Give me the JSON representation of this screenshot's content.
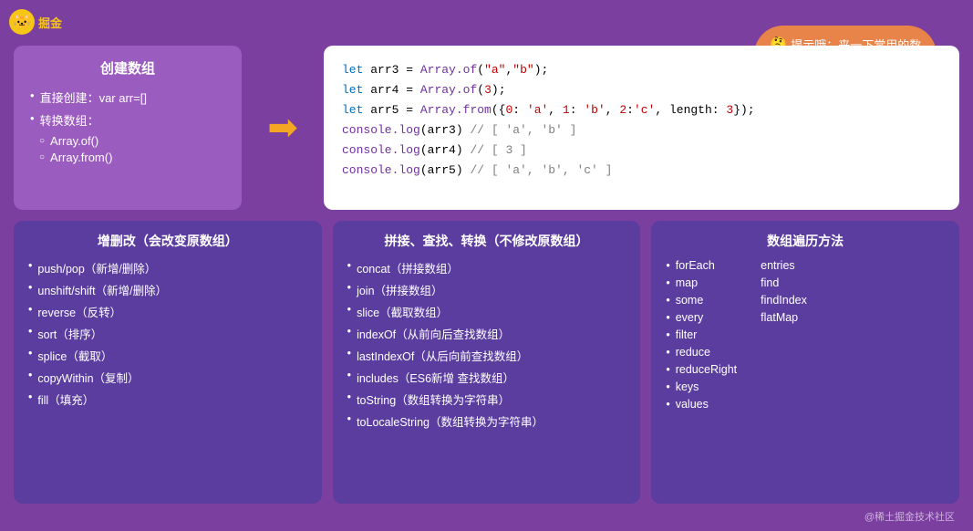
{
  "logo": {
    "icon": "🐱",
    "text": "掘金"
  },
  "tooltip": {
    "emoji": "🤔",
    "text": "提示哦：来一下常用的数组方法看看啥"
  },
  "create_box": {
    "title": "创建数组",
    "items": [
      "直接创建：var arr=[]",
      "转换数组："
    ],
    "sub_items": [
      "Array.of()",
      "Array.from()"
    ]
  },
  "code": {
    "lines": [
      {
        "text": "let arr3 = Array.of(\"a\",\"b\");"
      },
      {
        "text": "let arr4 = Array.of(3);"
      },
      {
        "text": "let arr5 = Array.from({0: 'a', 1: 'b', 2:'c', length: 3});"
      },
      {
        "text": "console.log(arr3) // [ 'a', 'b' ]"
      },
      {
        "text": "console.log(arr4) // [ 3 ]"
      },
      {
        "text": "console.log(arr5) // [ 'a', 'b', 'c' ]"
      }
    ]
  },
  "mutate_box": {
    "title": "增删改（会改变原数组）",
    "items": [
      "push/pop（新增/删除）",
      "unshift/shift（新增/删除）",
      "reverse（反转）",
      "sort（排序）",
      "splice（截取）",
      "copyWithin（复制）",
      "fill（填充）"
    ]
  },
  "search_box": {
    "title": "拼接、查找、转换（不修改原数组）",
    "items": [
      "concat（拼接数组）",
      "join（拼接数组）",
      "slice（截取数组）",
      "indexOf（从前向后查找数组）",
      "lastIndexOf（从后向前查找数组）",
      "includes（ES6新增 查找数组）",
      "toString（数组转换为字符串）",
      "toLocaleString（数组转换为字符串）"
    ]
  },
  "traverse_box": {
    "title": "数组遍历方法",
    "col1": [
      "forEach",
      "map",
      "some",
      "every",
      "filter",
      "reduce",
      "reduceRight",
      "keys",
      "values"
    ],
    "col2": [
      "entries",
      "find",
      "findIndex",
      "flatMap"
    ]
  },
  "footer": "@稀土掘金技术社区"
}
